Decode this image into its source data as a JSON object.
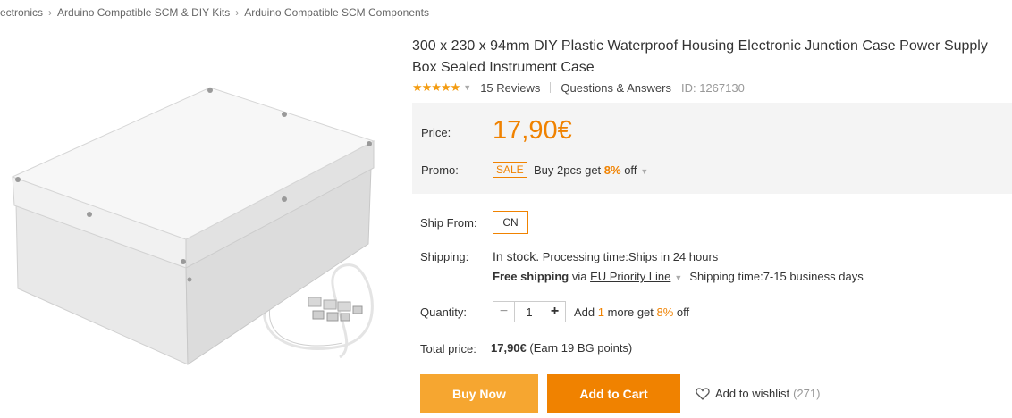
{
  "breadcrumb": [
    "ectronics",
    "Arduino Compatible SCM & DIY Kits",
    "Arduino Compatible SCM Components"
  ],
  "product": {
    "title": "300 x 230 x 94mm DIY Plastic Waterproof Housing Electronic Junction Case Power Supply Box Sealed Instrument Case",
    "rating_stars": "★★★★★",
    "reviews": "15 Reviews",
    "qa": "Questions & Answers",
    "id": "ID: 1267130"
  },
  "price": {
    "label": "Price:",
    "value": "17,90€"
  },
  "promo": {
    "label": "Promo:",
    "tag": "SALE",
    "text_prefix": "Buy 2pcs get ",
    "discount": "8%",
    "text_suffix": " off"
  },
  "shipping": {
    "from_label": "Ship From:",
    "from_value": "CN",
    "label": "Shipping:",
    "stock": "In stock.",
    "processing": " Processing time:Ships in 24 hours",
    "free": "Free shipping",
    "via": " via ",
    "method": "EU Priority Line",
    "time": "Shipping time:7-15 business days"
  },
  "quantity": {
    "label": "Quantity:",
    "value": "1",
    "minus": "−",
    "plus": "+",
    "note_prefix": "Add ",
    "note_count": "1",
    "note_mid": " more get ",
    "note_discount": "8%",
    "note_suffix": " off"
  },
  "total": {
    "label": "Total price:",
    "value": "17,90€",
    "points": " (Earn 19 BG points)"
  },
  "actions": {
    "buy_now": "Buy Now",
    "add_to_cart": "Add to Cart",
    "wishlist": "Add to wishlist",
    "wishlist_count": "(271)"
  },
  "colors": {
    "accent": "#f08200",
    "buy_now": "#f6a630",
    "price_bg": "#f4f4f4",
    "stars": "#f39c12"
  }
}
